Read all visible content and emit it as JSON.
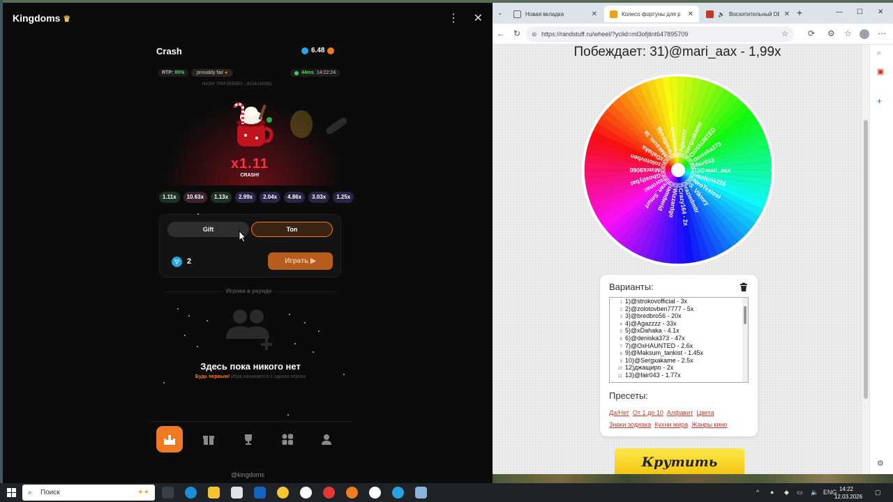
{
  "miniapp": {
    "title": "Kingdoms",
    "game_title": "Crash",
    "balance": "6.48",
    "rtp_label": "RTP:",
    "rtp_value": "95%",
    "fair_label": "provably fair",
    "ping": "44ms",
    "time": "14:22:24",
    "hash": "HASH    795F2E69D0...8216180361",
    "multiplier": "x1.11",
    "crashed_label": "CRASH!",
    "history": [
      "1.11x",
      "10.63x",
      "1.13x",
      "2.99x",
      "2.04x",
      "4.86x",
      "3.03x",
      "1.25x"
    ],
    "mode_gift": "Gift",
    "mode_ton": "Ton",
    "bet_amount": "2",
    "play_label": "Играть",
    "round_players_label": "Игроки в раунде",
    "empty_title": "Здесь пока никого нет",
    "empty_sub_highlight": "Будь первым!",
    "empty_sub": "Игра начинается с одного игрока",
    "footer": "@kingdoms"
  },
  "browser": {
    "tabs": [
      {
        "label": "Новая вкладка",
        "color": "#5f6368"
      },
      {
        "label": "Колесо фортуны для розы",
        "color": "#e8a317"
      },
      {
        "label": "Восхитительный DEEP",
        "color": "#c0392b"
      }
    ],
    "url": "https://randstuff.ru/wheel/?yclid=ml3ofjtint6478957​09"
  },
  "wheel_page": {
    "winner": "Побеждает: 31)@mari_aax - 1,99x",
    "variants_title": "Варианты:",
    "variants": [
      "1)@strokovofficial - 3x",
      "2)@zolotovben7777 - 5x",
      "3)@bredbro56 - 20x",
      "4)@Agazzzz - 33x",
      "5)@xDahaka - 4.1x",
      "6)@deniska373 - 47x",
      "7)@OxHAUNTED - 2.6x",
      "9)@Maksum_tankist - 1.45x",
      "10)@Sergxakame - 2.5x",
      "12)джащиро - 2x",
      "13)@fair043 - 1.77x"
    ],
    "wheel_labels": [
      "31)@mari_aax",
      "@molorik228",
      "@NeoTestost",
      "@S_Viktory",
      "@raziedmitr",
      "@Crazy164 - 2x",
      "@Wizzardgo",
      "@iamdwrid",
      "@van_Smurf",
      "@toronaz",
      "@Ghostlybat",
      "@Mimik9060",
      "@zolotovben",
      "@xDahaka",
      "@Maksum_ta",
      "@bredbro56",
      "@strokovo",
      "@Agazzzz",
      "@Sergxakame",
      "@OxHAUNTED",
      "@deniska373",
      "@fair043"
    ],
    "presets_title": "Пресеты:",
    "presets": [
      "Да/Нет",
      "От 1 до 10",
      "Алфавит",
      "Цвета",
      "Знаки зодиака",
      "Кухни мира",
      "Жанры кино"
    ],
    "spin_label": "Крутить"
  },
  "taskbar": {
    "search_placeholder": "Поиск",
    "lang": "ENG",
    "time": "14:22",
    "date": "12.03.2026"
  }
}
